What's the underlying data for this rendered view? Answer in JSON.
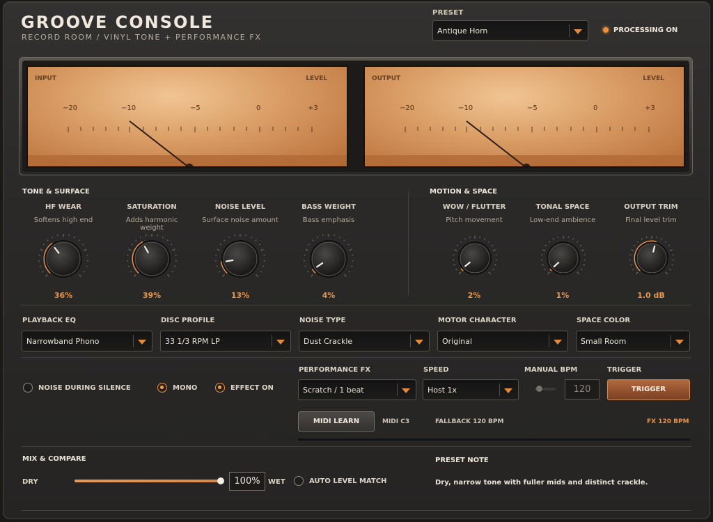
{
  "header": {
    "title": "GROOVE CONSOLE",
    "subtitle": "RECORD ROOM / VINYL TONE + PERFORMANCE FX",
    "preset_label": "PRESET",
    "preset_value": "Antique Horn",
    "processing_label": "PROCESSING ON",
    "accent_color": "#e8944b"
  },
  "meters": {
    "input": {
      "title": "INPUT",
      "right": "LEVEL",
      "scale": [
        "−20",
        "−10",
        "−5",
        "0",
        "+3"
      ]
    },
    "output": {
      "title": "OUTPUT",
      "right": "LEVEL",
      "scale": [
        "−20",
        "−10",
        "−5",
        "0",
        "+3"
      ]
    }
  },
  "tone_surface": {
    "title": "TONE & SURFACE",
    "knobs": [
      {
        "name": "HF WEAR",
        "desc": "Softens high end",
        "value": "36%",
        "level": 0.36
      },
      {
        "name": "SATURATION",
        "desc": "Adds harmonic weight",
        "value": "39%",
        "level": 0.39
      },
      {
        "name": "NOISE LEVEL",
        "desc": "Surface noise amount",
        "value": "13%",
        "level": 0.13
      },
      {
        "name": "BASS WEIGHT",
        "desc": "Bass emphasis",
        "value": "4%",
        "level": 0.04
      }
    ]
  },
  "motion_space": {
    "title": "MOTION & SPACE",
    "knobs": [
      {
        "name": "WOW / FLUTTER",
        "desc": "Pitch movement",
        "value": "2%",
        "level": 0.02
      },
      {
        "name": "TONAL SPACE",
        "desc": "Low-end ambience",
        "value": "1%",
        "level": 0.01
      },
      {
        "name": "OUTPUT TRIM",
        "desc": "Final level trim",
        "value": "1.0 dB",
        "level": 0.55
      }
    ]
  },
  "selects": {
    "playback_eq": {
      "label": "PLAYBACK EQ",
      "value": "Narrowband Phono"
    },
    "disc_profile": {
      "label": "DISC PROFILE",
      "value": "33 1/3 RPM LP"
    },
    "noise_type": {
      "label": "NOISE TYPE",
      "value": "Dust Crackle"
    },
    "motor_character": {
      "label": "MOTOR CHARACTER",
      "value": "Original"
    },
    "space_color": {
      "label": "SPACE COLOR",
      "value": "Small Room"
    },
    "performance_fx": {
      "label": "PERFORMANCE FX",
      "value": "Scratch / 1 beat"
    },
    "speed": {
      "label": "SPEED",
      "value": "Host 1x"
    }
  },
  "toggles": {
    "noise_during_silence": "NOISE DURING SILENCE",
    "mono": "MONO",
    "effect_on": "EFFECT ON"
  },
  "fx": {
    "manual_bpm_label": "MANUAL BPM",
    "manual_bpm_value": "120",
    "trigger_label": "TRIGGER",
    "trigger_button": "TRIGGER",
    "midi_learn": "MIDI LEARN",
    "midi_note": "MIDI C3",
    "fallback": "FALLBACK 120 BPM",
    "fx_bpm": "FX 120 BPM"
  },
  "mix": {
    "title": "MIX & COMPARE",
    "dry": "DRY",
    "wet": "WET",
    "value": "100%",
    "level": 1.0,
    "auto_level": "AUTO LEVEL MATCH"
  },
  "preset_note": {
    "title": "PRESET NOTE",
    "text": "Dry, narrow tone with fuller mids and distinct crackle."
  }
}
